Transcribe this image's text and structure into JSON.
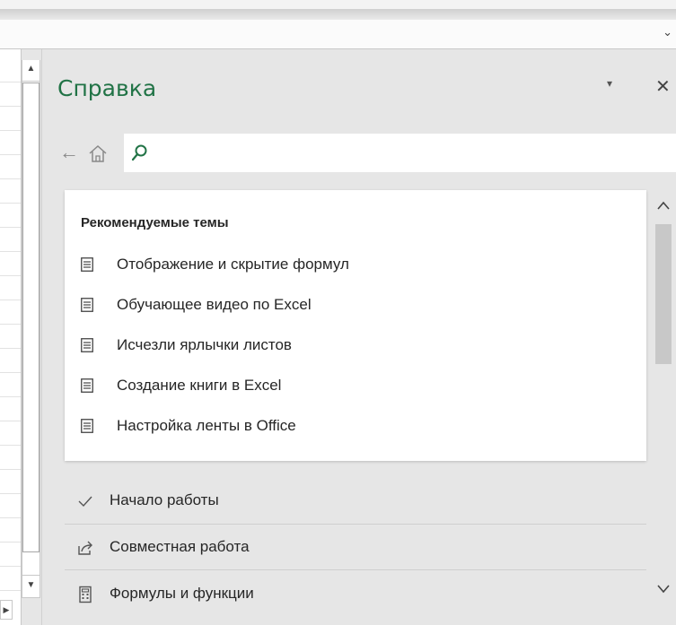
{
  "pane": {
    "title": "Справка",
    "menu_glyph": "▾",
    "close_glyph": "✕"
  },
  "nav": {
    "back_glyph": "←",
    "search_placeholder": ""
  },
  "recommended": {
    "heading": "Рекомендуемые темы",
    "topics": [
      "Отображение и скрытие формул",
      "Обучающее видео по Excel",
      "Исчезли ярлычки листов",
      "Создание книги в Excel",
      "Настройка ленты в Office"
    ]
  },
  "sections": [
    {
      "label": "Начало работы",
      "icon": "checkmark-icon"
    },
    {
      "label": "Совместная работа",
      "icon": "share-icon"
    },
    {
      "label": "Формулы и функции",
      "icon": "calculator-icon"
    }
  ],
  "colors": {
    "accent": "#217346",
    "pane_bg": "#e6e6e6"
  }
}
